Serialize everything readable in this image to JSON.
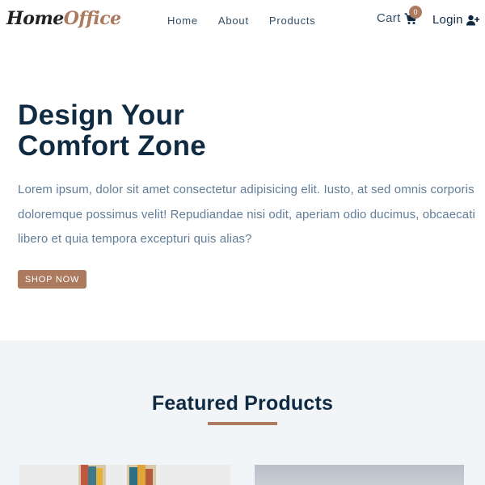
{
  "navbar": {
    "logo_part1": "Home",
    "logo_part2": "Office",
    "links": [
      "Home",
      "About",
      "Products"
    ],
    "cart_label": "Cart",
    "cart_count": "0",
    "login_label": "Login"
  },
  "hero": {
    "title_line1": "Design Your",
    "title_line2": "Comfort Zone",
    "text": "Lorem ipsum, dolor sit amet consectetur adipisicing elit. Iusto, at sed omnis corporis doloremque possimus velit! Repudiandae nisi odit, aperiam odio ducimus, obcaecati libero et quia tempora excepturi quis alias?",
    "button_label": "Shop Now"
  },
  "featured": {
    "title": "Featured Products"
  },
  "colors": {
    "primary": "#ab7a5f",
    "heading": "#102a42",
    "text": "#617d98",
    "section_bg": "#f1f5f8"
  },
  "icons": [
    "cart-icon",
    "user-plus-icon"
  ]
}
